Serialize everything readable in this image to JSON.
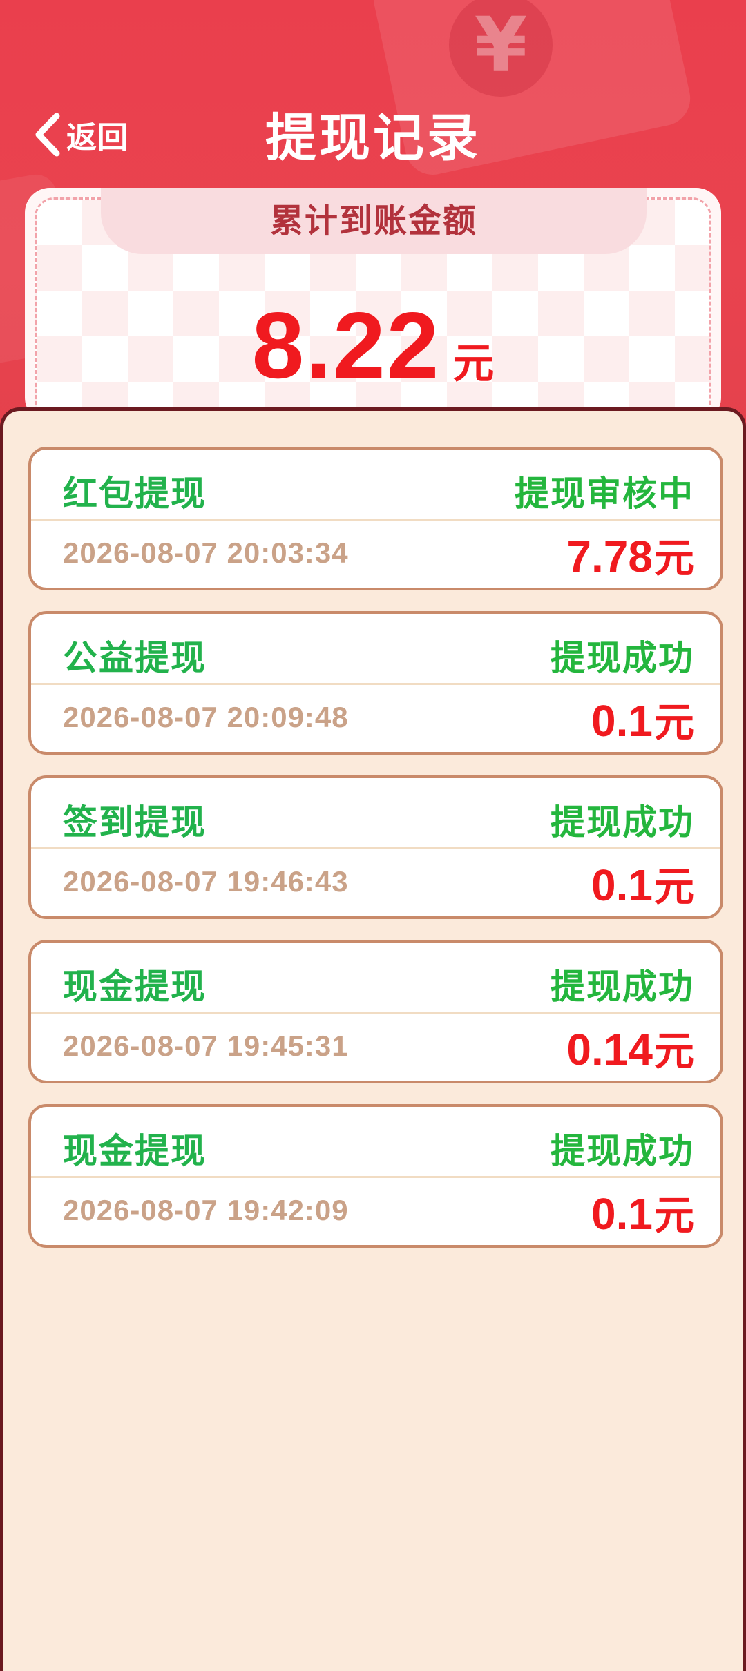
{
  "header": {
    "back_label": "返回",
    "title": "提现记录"
  },
  "summary": {
    "label": "累计到账金额",
    "amount": "8.22",
    "unit": "元"
  },
  "records": [
    {
      "type": "红包提现",
      "status": "提现审核中",
      "time": "2026-08-07 20:03:34",
      "amount": "7.78",
      "unit": "元"
    },
    {
      "type": "公益提现",
      "status": "提现成功",
      "time": "2026-08-07 20:09:48",
      "amount": "0.1",
      "unit": "元"
    },
    {
      "type": "签到提现",
      "status": "提现成功",
      "time": "2026-08-07 19:46:43",
      "amount": "0.1",
      "unit": "元"
    },
    {
      "type": "现金提现",
      "status": "提现成功",
      "time": "2026-08-07 19:45:31",
      "amount": "0.14",
      "unit": "元"
    },
    {
      "type": "现金提现",
      "status": "提现成功",
      "time": "2026-08-07 19:42:09",
      "amount": "0.1",
      "unit": "元"
    }
  ],
  "colors": {
    "header_bg": "#ea3f4d",
    "panel_bg": "#fbeadb",
    "type_green": "#22b24c",
    "status_green": "#24b63d",
    "amount_red": "#f01a1f",
    "time_tan": "#caa288",
    "card_border": "#c98a6a"
  },
  "icons": {
    "back": "chevron-left-icon",
    "decor_coin": "yuan-coin-icon"
  },
  "decor": {
    "coin_glyph": "¥"
  }
}
